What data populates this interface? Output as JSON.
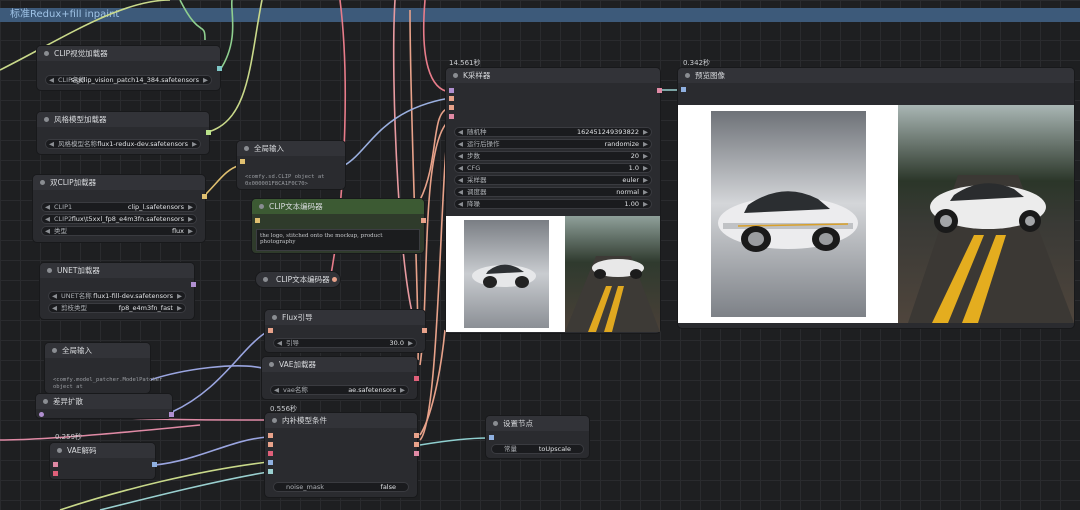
{
  "group": {
    "title": "标准Redux+fill inpaint"
  },
  "timers": {
    "ksampler": "14.561秒",
    "preview": "0.342秒",
    "vae_encode": "0.556秒",
    "vae_decode": "0.259秒"
  },
  "nodes": {
    "clip_vision": {
      "title": "CLIP视觉加载器",
      "widget_label": "CLIP名称",
      "widget_value": "sigclip_vision_patch14_384.safetensors"
    },
    "style_model": {
      "title": "风格模型加载器",
      "widget_label": "风格模型名称",
      "widget_value": "flux1-redux-dev.safetensors"
    },
    "global_input_1": {
      "title": "全局输入",
      "text": "<comfy.sd.CLIP object at 0x000001F8CA1F0C70>"
    },
    "dual_clip": {
      "title": "双CLIP加载器",
      "widgets": [
        {
          "label": "CLIP1",
          "value": "clip_l.safetensors"
        },
        {
          "label": "CLIP2",
          "value": "flux\\t5xxl_fp8_e4m3fn.safetensors"
        },
        {
          "label": "类型",
          "value": "flux"
        }
      ]
    },
    "clip_text_1": {
      "title": "CLIP文本编码器",
      "text": "the logo, stitched onto the mockup, product photography"
    },
    "clip_text_2": {
      "title": "CLIP文本编码器"
    },
    "unet": {
      "title": "UNET加载器",
      "widgets": [
        {
          "label": "UNET名称",
          "value": "flux1-fill-dev.safetensors"
        },
        {
          "label": "剪枝类型",
          "value": "fp8_e4m3fn_fast"
        }
      ]
    },
    "flux_guidance": {
      "title": "Flux引导",
      "widget_label": "引导",
      "widget_value": "30.0"
    },
    "global_input_2": {
      "title": "全局输入",
      "text": "<comfy.model_patcher.ModelPatcher object at"
    },
    "vae_loader": {
      "title": "VAE加载器",
      "widget_label": "vae名称",
      "widget_value": "ae.safetensors"
    },
    "diff_expand": {
      "title": "差异扩散"
    },
    "vae_decode": {
      "title": "VAE解码"
    },
    "inpaint_cond": {
      "title": "内补模型条件",
      "widget_label": "noise_mask",
      "widget_value": "false"
    },
    "set_node": {
      "title": "设置节点",
      "widget_label": "常量",
      "widget_value": "toUpscale"
    },
    "ksampler": {
      "title": "K采样器",
      "widgets": [
        {
          "label": "随机种",
          "value": "162451249393822"
        },
        {
          "label": "运行后操作",
          "value": "randomize"
        },
        {
          "label": "步数",
          "value": "20"
        },
        {
          "label": "CFG",
          "value": "1.0"
        },
        {
          "label": "采样器",
          "value": "euler"
        },
        {
          "label": "调度器",
          "value": "normal"
        },
        {
          "label": "降噪",
          "value": "1.00"
        }
      ]
    },
    "preview": {
      "title": "预览图像"
    }
  },
  "icons": {
    "arrow_left": "◀",
    "arrow_right": "▶"
  }
}
